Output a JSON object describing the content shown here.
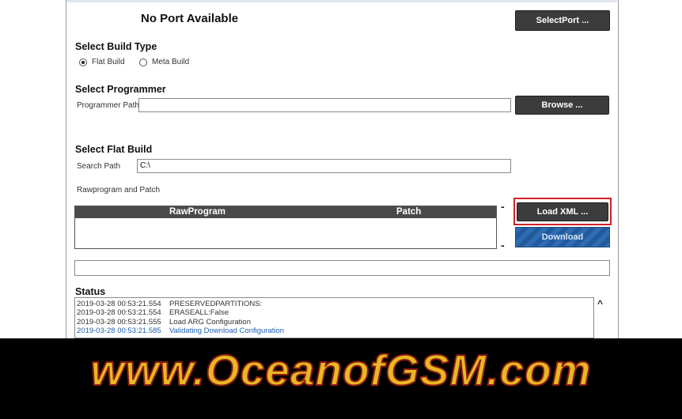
{
  "port": {
    "status_text": "No Port Available",
    "select_port_label": "SelectPort ..."
  },
  "build_type": {
    "heading": "Select Build Type",
    "options": [
      {
        "label": "Flat Build",
        "selected": true
      },
      {
        "label": "Meta Build",
        "selected": false
      }
    ]
  },
  "programmer": {
    "heading": "Select Programmer",
    "path_label": "Programmer Path",
    "path_value": "",
    "browse_label": "Browse ..."
  },
  "flat_build": {
    "heading": "Select Flat Build",
    "search_label": "Search Path",
    "search_value": "C:\\",
    "rawprogram_label": "Rawprogram and Patch",
    "columns": [
      "RawProgram",
      "Patch"
    ],
    "minus_top": "-",
    "minus_bottom": "-",
    "load_xml_label": "Load XML ...",
    "download_label": "Download"
  },
  "status": {
    "heading": "Status",
    "scroll_up": "^",
    "lines": [
      {
        "time": "2019-03-28 00:53:21.554",
        "message": "PRESERVEDPARTITIONS:",
        "color": "#333333"
      },
      {
        "time": "2019-03-28 00:53:21.554",
        "message": "ERASEALL:False",
        "color": "#333333"
      },
      {
        "time": "2019-03-28 00:53:21.555",
        "message": "Load ARG Configuration",
        "color": "#333333"
      },
      {
        "time": "2019-03-28 00:53:21.585",
        "message": "Validating Download Configuration",
        "color": "#1a5fb4"
      }
    ]
  },
  "watermark": {
    "text": "www.OceanofGSM.com",
    "fill_color": "#e8b822",
    "outline_color": "#8a1c10"
  },
  "colors": {
    "button_dark": "#3c3c3c",
    "highlight_red": "#d42028",
    "download_blue": "#2e6cb3"
  }
}
